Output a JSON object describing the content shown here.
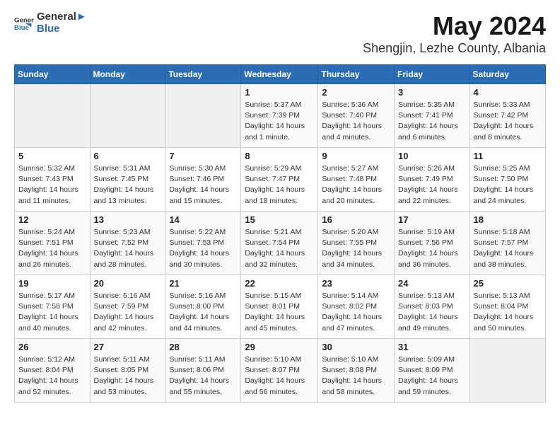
{
  "header": {
    "logo_general": "General",
    "logo_blue": "Blue",
    "title": "May 2024",
    "location": "Shengjin, Lezhe County, Albania"
  },
  "weekdays": [
    "Sunday",
    "Monday",
    "Tuesday",
    "Wednesday",
    "Thursday",
    "Friday",
    "Saturday"
  ],
  "weeks": [
    [
      {
        "day": "",
        "empty": true
      },
      {
        "day": "",
        "empty": true
      },
      {
        "day": "",
        "empty": true
      },
      {
        "day": "1",
        "sunrise": "5:37 AM",
        "sunset": "7:39 PM",
        "daylight": "14 hours and 1 minute."
      },
      {
        "day": "2",
        "sunrise": "5:36 AM",
        "sunset": "7:40 PM",
        "daylight": "14 hours and 4 minutes."
      },
      {
        "day": "3",
        "sunrise": "5:35 AM",
        "sunset": "7:41 PM",
        "daylight": "14 hours and 6 minutes."
      },
      {
        "day": "4",
        "sunrise": "5:33 AM",
        "sunset": "7:42 PM",
        "daylight": "14 hours and 8 minutes."
      }
    ],
    [
      {
        "day": "5",
        "sunrise": "5:32 AM",
        "sunset": "7:43 PM",
        "daylight": "14 hours and 11 minutes."
      },
      {
        "day": "6",
        "sunrise": "5:31 AM",
        "sunset": "7:45 PM",
        "daylight": "14 hours and 13 minutes."
      },
      {
        "day": "7",
        "sunrise": "5:30 AM",
        "sunset": "7:46 PM",
        "daylight": "14 hours and 15 minutes."
      },
      {
        "day": "8",
        "sunrise": "5:29 AM",
        "sunset": "7:47 PM",
        "daylight": "14 hours and 18 minutes."
      },
      {
        "day": "9",
        "sunrise": "5:27 AM",
        "sunset": "7:48 PM",
        "daylight": "14 hours and 20 minutes."
      },
      {
        "day": "10",
        "sunrise": "5:26 AM",
        "sunset": "7:49 PM",
        "daylight": "14 hours and 22 minutes."
      },
      {
        "day": "11",
        "sunrise": "5:25 AM",
        "sunset": "7:50 PM",
        "daylight": "14 hours and 24 minutes."
      }
    ],
    [
      {
        "day": "12",
        "sunrise": "5:24 AM",
        "sunset": "7:51 PM",
        "daylight": "14 hours and 26 minutes."
      },
      {
        "day": "13",
        "sunrise": "5:23 AM",
        "sunset": "7:52 PM",
        "daylight": "14 hours and 28 minutes."
      },
      {
        "day": "14",
        "sunrise": "5:22 AM",
        "sunset": "7:53 PM",
        "daylight": "14 hours and 30 minutes."
      },
      {
        "day": "15",
        "sunrise": "5:21 AM",
        "sunset": "7:54 PM",
        "daylight": "14 hours and 32 minutes."
      },
      {
        "day": "16",
        "sunrise": "5:20 AM",
        "sunset": "7:55 PM",
        "daylight": "14 hours and 34 minutes."
      },
      {
        "day": "17",
        "sunrise": "5:19 AM",
        "sunset": "7:56 PM",
        "daylight": "14 hours and 36 minutes."
      },
      {
        "day": "18",
        "sunrise": "5:18 AM",
        "sunset": "7:57 PM",
        "daylight": "14 hours and 38 minutes."
      }
    ],
    [
      {
        "day": "19",
        "sunrise": "5:17 AM",
        "sunset": "7:58 PM",
        "daylight": "14 hours and 40 minutes."
      },
      {
        "day": "20",
        "sunrise": "5:16 AM",
        "sunset": "7:59 PM",
        "daylight": "14 hours and 42 minutes."
      },
      {
        "day": "21",
        "sunrise": "5:16 AM",
        "sunset": "8:00 PM",
        "daylight": "14 hours and 44 minutes."
      },
      {
        "day": "22",
        "sunrise": "5:15 AM",
        "sunset": "8:01 PM",
        "daylight": "14 hours and 45 minutes."
      },
      {
        "day": "23",
        "sunrise": "5:14 AM",
        "sunset": "8:02 PM",
        "daylight": "14 hours and 47 minutes."
      },
      {
        "day": "24",
        "sunrise": "5:13 AM",
        "sunset": "8:03 PM",
        "daylight": "14 hours and 49 minutes."
      },
      {
        "day": "25",
        "sunrise": "5:13 AM",
        "sunset": "8:04 PM",
        "daylight": "14 hours and 50 minutes."
      }
    ],
    [
      {
        "day": "26",
        "sunrise": "5:12 AM",
        "sunset": "8:04 PM",
        "daylight": "14 hours and 52 minutes."
      },
      {
        "day": "27",
        "sunrise": "5:11 AM",
        "sunset": "8:05 PM",
        "daylight": "14 hours and 53 minutes."
      },
      {
        "day": "28",
        "sunrise": "5:11 AM",
        "sunset": "8:06 PM",
        "daylight": "14 hours and 55 minutes."
      },
      {
        "day": "29",
        "sunrise": "5:10 AM",
        "sunset": "8:07 PM",
        "daylight": "14 hours and 56 minutes."
      },
      {
        "day": "30",
        "sunrise": "5:10 AM",
        "sunset": "8:08 PM",
        "daylight": "14 hours and 58 minutes."
      },
      {
        "day": "31",
        "sunrise": "5:09 AM",
        "sunset": "8:09 PM",
        "daylight": "14 hours and 59 minutes."
      },
      {
        "day": "",
        "empty": true
      }
    ]
  ]
}
